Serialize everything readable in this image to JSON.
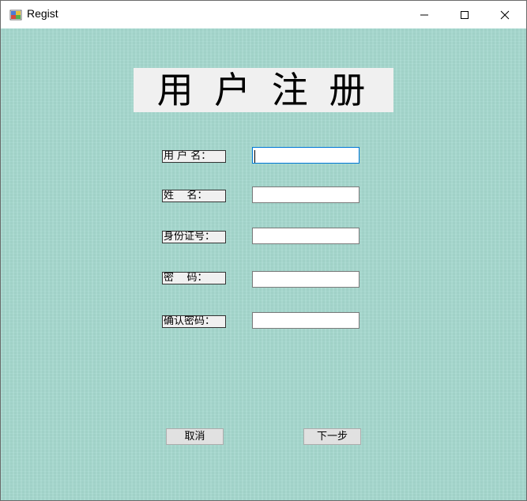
{
  "window": {
    "title": "Regist"
  },
  "form": {
    "heading": "用 户 注 册",
    "fields": [
      {
        "label": "用 户 名：",
        "value": ""
      },
      {
        "label": "姓    名：",
        "value": ""
      },
      {
        "label": "身份证号：",
        "value": ""
      },
      {
        "label": "密    码：",
        "value": ""
      },
      {
        "label": "确认密码：",
        "value": ""
      }
    ],
    "buttons": {
      "cancel": "取消",
      "next": "下一步"
    }
  },
  "colors": {
    "background": "#a6d9cf",
    "focus_border": "#0078d7"
  }
}
